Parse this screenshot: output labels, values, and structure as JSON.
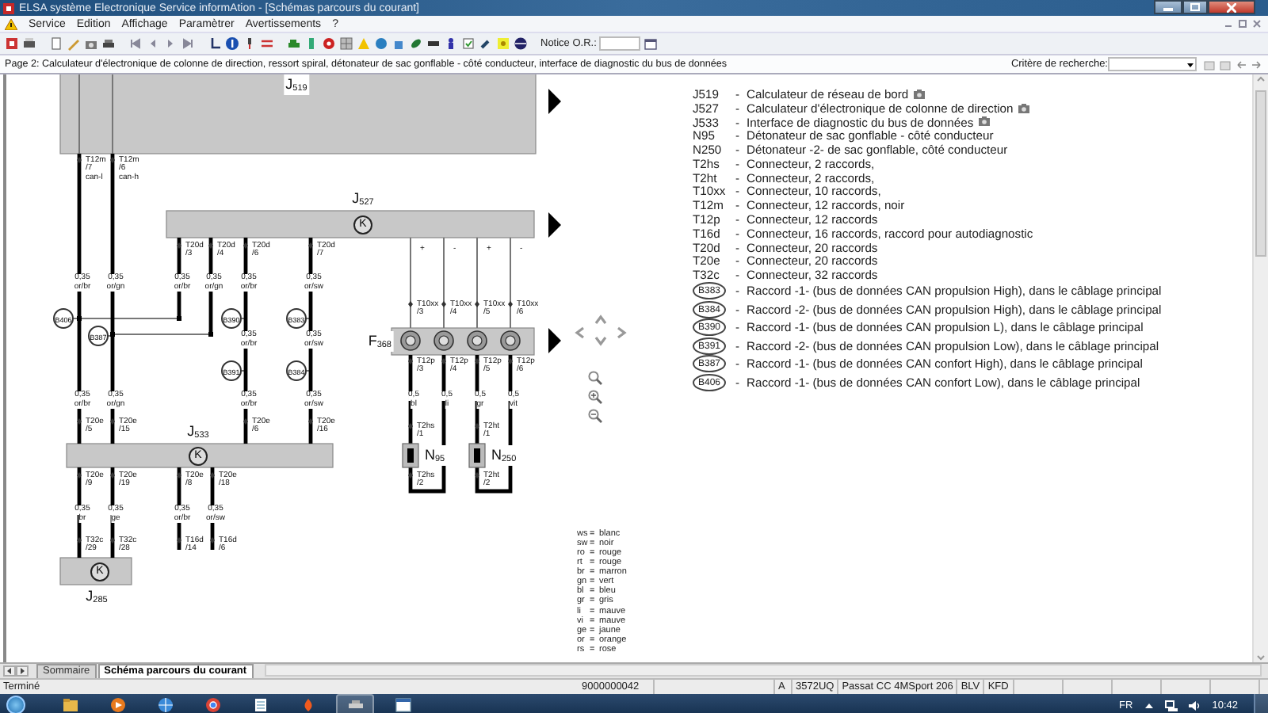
{
  "window": {
    "title": "ELSA système Electronique Service informAtion - [Schémas parcours du courant]"
  },
  "menu": [
    "Service",
    "Edition",
    "Affichage",
    "Paramètrer",
    "Avertissements",
    "?"
  ],
  "toolbar": {
    "notice_label": "Notice O.R.:"
  },
  "page_bar": {
    "title": "Page 2: Calculateur d'électronique de colonne de direction, ressort spiral, détonateur de sac gonflable - côté conducteur, interface de diagnostic du bus de données",
    "search_label": "Critère de recherche:"
  },
  "diagram": {
    "modules": [
      {
        "label": "J$_{519}$"
      },
      {
        "label": "J$_{527}$",
        "symbol": "K"
      },
      {
        "label": "J$_{533}$",
        "symbol": "K"
      },
      {
        "label": "J$_{285}$",
        "symbol": "K"
      },
      {
        "label": "F$_{368}$"
      },
      {
        "label": "N$_{95}$"
      },
      {
        "label": "N$_{250}$"
      }
    ],
    "pins": [
      {
        "connector": "T12m",
        "pin": "/7",
        "signal": "can-l"
      },
      {
        "connector": "T12m",
        "pin": "/6",
        "signal": "can-h"
      },
      {
        "connector": "T20d",
        "pin": "/3"
      },
      {
        "connector": "T20d",
        "pin": "/4"
      },
      {
        "connector": "T20d",
        "pin": "/6"
      },
      {
        "connector": "T20d",
        "pin": "/7"
      },
      {
        "connector": "T10xx",
        "pin": "/3"
      },
      {
        "connector": "T10xx",
        "pin": "/4"
      },
      {
        "connector": "T10xx",
        "pin": "/5"
      },
      {
        "connector": "T10xx",
        "pin": "/6"
      },
      {
        "connector": "T12p",
        "pin": "/3"
      },
      {
        "connector": "T12p",
        "pin": "/4"
      },
      {
        "connector": "T12p",
        "pin": "/5"
      },
      {
        "connector": "T12p",
        "pin": "/6"
      },
      {
        "connector": "T20e",
        "pin": "/5"
      },
      {
        "connector": "T20e",
        "pin": "/15"
      },
      {
        "connector": "T20e",
        "pin": "/6"
      },
      {
        "connector": "T20e",
        "pin": "/16"
      },
      {
        "connector": "T2hs",
        "pin": "/1"
      },
      {
        "connector": "T2ht",
        "pin": "/1"
      },
      {
        "connector": "T20e",
        "pin": "/9"
      },
      {
        "connector": "T20e",
        "pin": "/19"
      },
      {
        "connector": "T20e",
        "pin": "/8"
      },
      {
        "connector": "T20e",
        "pin": "/18"
      },
      {
        "connector": "T2hs",
        "pin": "/2"
      },
      {
        "connector": "T2ht",
        "pin": "/2"
      },
      {
        "connector": "T32c",
        "pin": "/29"
      },
      {
        "connector": "T32c",
        "pin": "/28"
      },
      {
        "connector": "T16d",
        "pin": "/14"
      },
      {
        "connector": "T16d",
        "pin": "/6"
      }
    ],
    "wire_labels": [
      {
        "gauge": "0,35",
        "insulation": "or/br"
      },
      {
        "gauge": "0,35",
        "insulation": "or/gn"
      },
      {
        "gauge": "0,35",
        "insulation": "or/br"
      },
      {
        "gauge": "0,35",
        "insulation": "or/gn"
      },
      {
        "gauge": "0,35",
        "insulation": "or/br"
      },
      {
        "gauge": "0,35",
        "insulation": "or/sw"
      },
      {
        "gauge": "0,35",
        "insulation": "or/br"
      },
      {
        "gauge": "0,35",
        "insulation": "or/sw"
      },
      {
        "gauge": "0,35",
        "insulation": "or/br"
      },
      {
        "gauge": "0,35",
        "insulation": "or/gn"
      },
      {
        "gauge": "0,35",
        "insulation": "or/br"
      },
      {
        "gauge": "0,35",
        "insulation": "or/sw"
      },
      {
        "gauge": "0,5",
        "insulation": "bl"
      },
      {
        "gauge": "0,5",
        "insulation": "li"
      },
      {
        "gauge": "0,5",
        "insulation": "gr"
      },
      {
        "gauge": "0,5",
        "insulation": "vit"
      },
      {
        "gauge": "0,35",
        "insulation": "br"
      },
      {
        "gauge": "0,35",
        "insulation": "ge"
      },
      {
        "gauge": "0,35",
        "insulation": "or/br"
      },
      {
        "gauge": "0,35",
        "insulation": "or/sw"
      }
    ],
    "splices": [
      "B406",
      "B387",
      "B390",
      "B383",
      "B391",
      "B384"
    ],
    "polarity": [
      "+",
      "-",
      "+",
      "-"
    ]
  },
  "legend": {
    "components": [
      {
        "kind": "component",
        "code": "J519",
        "sep": "-",
        "text": "Calculateur de réseau de bord",
        "icon": true
      },
      {
        "kind": "component",
        "code": "J527",
        "sep": "-",
        "text": "Calculateur d'électronique de colonne de direction",
        "icon": true
      },
      {
        "kind": "component",
        "code": "J533",
        "sep": "-",
        "text": "Interface de diagnostic du bus de données",
        "icon": true
      },
      {
        "kind": "component",
        "code": "N95",
        "sep": "-",
        "text": "Détonateur de sac gonflable - côté conducteur",
        "icon": false
      },
      {
        "kind": "component",
        "code": "N250",
        "sep": "-",
        "text": "Détonateur -2- de sac gonflable, côté conducteur",
        "icon": false
      },
      {
        "kind": "component",
        "code": "T2hs",
        "sep": "-",
        "text": "Connecteur, 2 raccords,",
        "icon": false
      },
      {
        "kind": "component",
        "code": "T2ht",
        "sep": "-",
        "text": "Connecteur, 2 raccords,",
        "icon": false
      },
      {
        "kind": "component",
        "code": "T10xx",
        "sep": "-",
        "text": "Connecteur, 10 raccords,",
        "icon": false
      },
      {
        "kind": "component",
        "code": "T12m",
        "sep": "-",
        "text": "Connecteur, 12 raccords, noir",
        "icon": false
      },
      {
        "kind": "component",
        "code": "T12p",
        "sep": "-",
        "text": "Connecteur, 12 raccords",
        "icon": false
      },
      {
        "kind": "component",
        "code": "T16d",
        "sep": "-",
        "text": "Connecteur, 16 raccords, raccord pour autodiagnostic",
        "icon": false
      },
      {
        "kind": "component",
        "code": "T20d",
        "sep": "-",
        "text": "Connecteur, 20 raccords",
        "icon": false
      },
      {
        "kind": "component",
        "code": "T20e",
        "sep": "-",
        "text": "Connecteur, 20 raccords",
        "icon": false
      },
      {
        "kind": "component",
        "code": "T32c",
        "sep": "-",
        "text": "Connecteur, 32 raccords",
        "icon": false
      },
      {
        "kind": "splice",
        "code": "B383",
        "sep": "-",
        "text": "Raccord -1- (bus de données CAN propulsion High), dans le câblage principal",
        "icon": false
      },
      {
        "kind": "splice",
        "code": "B384",
        "sep": "-",
        "text": "Raccord -2- (bus de données CAN propulsion High), dans le câblage principal",
        "icon": false
      },
      {
        "kind": "splice",
        "code": "B390",
        "sep": "-",
        "text": "Raccord -1- (bus de données CAN propulsion L), dans le câblage principal",
        "icon": false
      },
      {
        "kind": "splice",
        "code": "B391",
        "sep": "-",
        "text": "Raccord -2- (bus de données CAN propulsion Low), dans le câblage principal",
        "icon": false
      },
      {
        "kind": "splice",
        "code": "B387",
        "sep": "-",
        "text": "Raccord -1- (bus de données CAN confort High), dans le câblage principal",
        "icon": false
      },
      {
        "kind": "splice",
        "code": "B406",
        "sep": "-",
        "text": "Raccord -1- (bus de données CAN confort Low), dans le câblage principal",
        "icon": false
      }
    ],
    "colors": [
      {
        "code": "ws",
        "sep": "=",
        "name": "blanc"
      },
      {
        "code": "sw",
        "sep": "=",
        "name": "noir"
      },
      {
        "code": "ro",
        "sep": "=",
        "name": "rouge"
      },
      {
        "code": "rt",
        "sep": "=",
        "name": "rouge"
      },
      {
        "code": "br",
        "sep": "=",
        "name": "marron"
      },
      {
        "code": "gn",
        "sep": "=",
        "name": "vert"
      },
      {
        "code": "bl",
        "sep": "=",
        "name": "bleu"
      },
      {
        "code": "gr",
        "sep": "=",
        "name": "gris"
      },
      {
        "code": "li",
        "sep": "=",
        "name": "mauve"
      },
      {
        "code": "vi",
        "sep": "=",
        "name": "mauve"
      },
      {
        "code": "ge",
        "sep": "=",
        "name": "jaune"
      },
      {
        "code": "or",
        "sep": "=",
        "name": "orange"
      },
      {
        "code": "rs",
        "sep": "=",
        "name": "rose"
      }
    ]
  },
  "tabs": [
    {
      "label": "Sommaire",
      "selected": false
    },
    {
      "label": "Schéma parcours du courant",
      "selected": true
    }
  ],
  "status_bar": {
    "state": "Terminé",
    "fields": [
      "9000000042",
      "A",
      "3572UQ",
      "Passat CC 4MSport 206",
      "BLV",
      "KFD"
    ]
  },
  "taskbar": {
    "language": "FR",
    "clock": "10:42"
  }
}
